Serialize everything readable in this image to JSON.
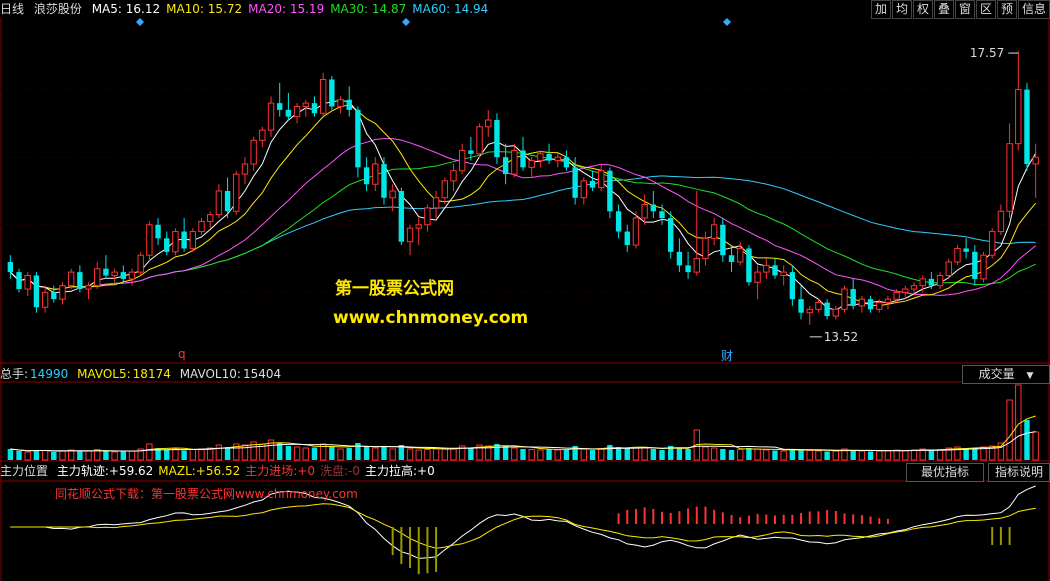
{
  "header": {
    "period": "日线",
    "stock": "浪莎股份",
    "ma": [
      {
        "label": "MA5:",
        "value": "16.12",
        "color": "#ffffff"
      },
      {
        "label": "MA10:",
        "value": "15.72",
        "color": "#ffe900"
      },
      {
        "label": "MA20:",
        "value": "15.19",
        "color": "#ff55ff"
      },
      {
        "label": "MA30:",
        "value": "14.87",
        "color": "#22dd22"
      },
      {
        "label": "MA60:",
        "value": "14.94",
        "color": "#33ccff"
      }
    ]
  },
  "toolbar": [
    "加",
    "均",
    "权",
    "叠",
    "窗",
    "区",
    "预",
    "信息"
  ],
  "main_panel": {
    "high_label": "17.57",
    "low_label": "13.52",
    "marker_q": "q",
    "marker_cai": "财",
    "watermark_title": "第一股票公式网",
    "watermark_url": "www.chnmoney.com"
  },
  "volume_panel": {
    "label": "总手:",
    "value": "14990",
    "mav5_label": "MAVOL5:",
    "mav5_value": "18174",
    "mav10_label": "MAVOL10:",
    "mav10_value": "15404",
    "dropdown": "成交量"
  },
  "indicator_panel": {
    "name": "主力位置",
    "items": [
      {
        "label": "主力轨迹:",
        "value": "+59.62",
        "color": "#ffffff"
      },
      {
        "label": "MAZL:",
        "value": "+56.52",
        "color": "#ffe900"
      },
      {
        "label": "主力进场:",
        "value": "+0",
        "color": "#ff3333"
      },
      {
        "label": "洗盘:",
        "value": "-0",
        "color": "#993333"
      },
      {
        "label": "主力拉高:",
        "value": "+0",
        "color": "#ffffff"
      }
    ],
    "btn_best": "最优指标",
    "btn_explain": "指标说明",
    "watermark": "同花顺公式下载：第一股票公式网www.chnmoney.com"
  },
  "colors": {
    "up": "#ff3232",
    "down": "#00e6e6",
    "bg": "#000000",
    "grid": "#8b0000"
  },
  "chart_data": {
    "type": "candlestick",
    "ylim": [
      13.0,
      18.0
    ],
    "high": 17.57,
    "low": 13.52,
    "ohlc": [
      [
        14.45,
        14.55,
        14.2,
        14.3
      ],
      [
        14.3,
        14.35,
        14.0,
        14.05
      ],
      [
        14.05,
        14.3,
        13.95,
        14.25
      ],
      [
        14.25,
        14.3,
        13.7,
        13.78
      ],
      [
        13.78,
        14.1,
        13.7,
        14.0
      ],
      [
        14.0,
        14.1,
        13.85,
        13.9
      ],
      [
        13.9,
        14.15,
        13.82,
        14.1
      ],
      [
        14.1,
        14.35,
        14.05,
        14.3
      ],
      [
        14.3,
        14.4,
        14.0,
        14.05
      ],
      [
        14.05,
        14.15,
        13.9,
        14.1
      ],
      [
        14.1,
        14.45,
        14.05,
        14.35
      ],
      [
        14.35,
        14.55,
        14.2,
        14.25
      ],
      [
        14.25,
        14.35,
        14.15,
        14.3
      ],
      [
        14.3,
        14.4,
        14.15,
        14.2
      ],
      [
        14.2,
        14.35,
        14.1,
        14.3
      ],
      [
        14.3,
        14.6,
        14.25,
        14.55
      ],
      [
        14.55,
        15.05,
        14.45,
        15.0
      ],
      [
        15.0,
        15.1,
        14.7,
        14.8
      ],
      [
        14.8,
        14.9,
        14.55,
        14.6
      ],
      [
        14.6,
        14.95,
        14.55,
        14.9
      ],
      [
        14.9,
        15.1,
        14.6,
        14.65
      ],
      [
        14.65,
        14.95,
        14.6,
        14.9
      ],
      [
        14.9,
        15.1,
        14.85,
        15.05
      ],
      [
        15.05,
        15.2,
        14.95,
        15.15
      ],
      [
        15.15,
        15.6,
        15.1,
        15.5
      ],
      [
        15.5,
        15.7,
        15.1,
        15.2
      ],
      [
        15.2,
        15.8,
        15.15,
        15.75
      ],
      [
        15.75,
        16.0,
        15.6,
        15.9
      ],
      [
        15.9,
        16.3,
        15.8,
        16.25
      ],
      [
        16.25,
        16.45,
        16.15,
        16.4
      ],
      [
        16.4,
        16.9,
        16.3,
        16.8
      ],
      [
        16.8,
        17.1,
        16.6,
        16.7
      ],
      [
        16.7,
        16.95,
        16.55,
        16.6
      ],
      [
        16.6,
        16.8,
        16.5,
        16.75
      ],
      [
        16.75,
        16.85,
        16.6,
        16.8
      ],
      [
        16.8,
        16.9,
        16.6,
        16.65
      ],
      [
        16.65,
        17.25,
        16.6,
        17.15
      ],
      [
        17.15,
        17.2,
        16.7,
        16.75
      ],
      [
        16.75,
        16.9,
        16.65,
        16.85
      ],
      [
        16.85,
        17.05,
        16.6,
        16.7
      ],
      [
        16.7,
        16.75,
        15.7,
        15.85
      ],
      [
        15.85,
        16.0,
        15.5,
        15.6
      ],
      [
        15.6,
        16.0,
        15.5,
        15.9
      ],
      [
        15.9,
        16.0,
        15.3,
        15.4
      ],
      [
        15.4,
        15.6,
        15.2,
        15.5
      ],
      [
        15.5,
        15.55,
        14.7,
        14.75
      ],
      [
        14.75,
        15.0,
        14.55,
        14.95
      ],
      [
        14.95,
        15.1,
        14.7,
        15.0
      ],
      [
        15.0,
        15.3,
        14.9,
        15.25
      ],
      [
        15.25,
        15.5,
        15.1,
        15.4
      ],
      [
        15.4,
        15.7,
        15.3,
        15.65
      ],
      [
        15.65,
        15.9,
        15.5,
        15.8
      ],
      [
        15.8,
        16.2,
        15.75,
        16.1
      ],
      [
        16.1,
        16.3,
        15.95,
        16.05
      ],
      [
        16.05,
        16.5,
        16.0,
        16.45
      ],
      [
        16.45,
        16.7,
        16.3,
        16.55
      ],
      [
        16.55,
        16.65,
        15.9,
        16.0
      ],
      [
        16.0,
        16.2,
        15.6,
        15.75
      ],
      [
        15.75,
        16.2,
        15.7,
        16.1
      ],
      [
        16.1,
        16.3,
        15.8,
        15.85
      ],
      [
        15.85,
        16.0,
        15.7,
        15.95
      ],
      [
        15.95,
        16.1,
        15.85,
        16.05
      ],
      [
        16.05,
        16.2,
        15.9,
        15.95
      ],
      [
        15.95,
        16.05,
        15.85,
        16.0
      ],
      [
        16.0,
        16.1,
        15.8,
        15.85
      ],
      [
        15.85,
        16.0,
        15.3,
        15.4
      ],
      [
        15.4,
        15.7,
        15.3,
        15.65
      ],
      [
        15.65,
        15.8,
        15.5,
        15.55
      ],
      [
        15.55,
        15.9,
        15.5,
        15.8
      ],
      [
        15.8,
        15.85,
        15.1,
        15.2
      ],
      [
        15.2,
        15.3,
        14.8,
        14.9
      ],
      [
        14.9,
        15.0,
        14.6,
        14.7
      ],
      [
        14.7,
        15.2,
        14.65,
        15.1
      ],
      [
        15.1,
        15.45,
        15.0,
        15.3
      ],
      [
        15.3,
        15.5,
        15.1,
        15.2
      ],
      [
        15.2,
        15.3,
        15.0,
        15.1
      ],
      [
        15.1,
        15.2,
        14.5,
        14.6
      ],
      [
        14.6,
        14.8,
        14.3,
        14.4
      ],
      [
        14.4,
        14.6,
        14.2,
        14.3
      ],
      [
        14.3,
        15.5,
        14.25,
        14.5
      ],
      [
        14.5,
        14.9,
        14.4,
        14.8
      ],
      [
        14.8,
        15.1,
        14.7,
        15.0
      ],
      [
        15.0,
        15.1,
        14.45,
        14.55
      ],
      [
        14.55,
        14.7,
        14.3,
        14.45
      ],
      [
        14.45,
        14.75,
        14.4,
        14.65
      ],
      [
        14.65,
        14.7,
        14.1,
        14.15
      ],
      [
        14.15,
        14.4,
        13.9,
        14.3
      ],
      [
        14.3,
        14.5,
        14.2,
        14.4
      ],
      [
        14.4,
        14.5,
        14.2,
        14.25
      ],
      [
        14.25,
        14.4,
        14.1,
        14.3
      ],
      [
        14.3,
        14.4,
        13.8,
        13.9
      ],
      [
        13.9,
        14.1,
        13.6,
        13.7
      ],
      [
        13.7,
        13.8,
        13.52,
        13.75
      ],
      [
        13.75,
        13.9,
        13.7,
        13.85
      ],
      [
        13.85,
        13.9,
        13.6,
        13.65
      ],
      [
        13.65,
        13.8,
        13.6,
        13.75
      ],
      [
        13.75,
        14.1,
        13.7,
        14.05
      ],
      [
        14.05,
        14.2,
        13.75,
        13.8
      ],
      [
        13.8,
        13.95,
        13.7,
        13.9
      ],
      [
        13.9,
        13.95,
        13.7,
        13.75
      ],
      [
        13.75,
        13.9,
        13.7,
        13.85
      ],
      [
        13.85,
        13.95,
        13.75,
        13.9
      ],
      [
        13.9,
        14.05,
        13.85,
        14.0
      ],
      [
        14.0,
        14.1,
        13.9,
        14.05
      ],
      [
        14.05,
        14.15,
        13.95,
        14.1
      ],
      [
        14.1,
        14.25,
        14.0,
        14.2
      ],
      [
        14.2,
        14.3,
        14.05,
        14.1
      ],
      [
        14.1,
        14.3,
        14.05,
        14.25
      ],
      [
        14.25,
        14.5,
        14.2,
        14.45
      ],
      [
        14.45,
        14.7,
        14.4,
        14.65
      ],
      [
        14.65,
        14.8,
        14.5,
        14.6
      ],
      [
        14.6,
        14.7,
        14.1,
        14.2
      ],
      [
        14.2,
        14.6,
        14.15,
        14.55
      ],
      [
        14.55,
        14.95,
        14.5,
        14.9
      ],
      [
        14.9,
        15.3,
        14.85,
        15.2
      ],
      [
        15.2,
        16.5,
        15.1,
        16.2
      ],
      [
        16.2,
        17.57,
        16.1,
        17.0
      ],
      [
        17.0,
        17.1,
        15.8,
        15.9
      ],
      [
        15.9,
        16.2,
        15.4,
        16.0
      ]
    ],
    "volume": [
      11000,
      9000,
      8000,
      10000,
      9500,
      8000,
      9000,
      10000,
      8500,
      9000,
      10500,
      9000,
      8000,
      8500,
      9000,
      11000,
      16000,
      12000,
      10000,
      11000,
      9500,
      10500,
      11000,
      12000,
      15000,
      13000,
      16000,
      15000,
      18000,
      16000,
      20000,
      17000,
      14000,
      13000,
      12000,
      12500,
      16000,
      14000,
      11000,
      12000,
      17000,
      14000,
      12000,
      13000,
      11000,
      15000,
      11000,
      10000,
      10500,
      11000,
      12000,
      11500,
      14000,
      12000,
      15000,
      14000,
      16000,
      14000,
      12000,
      11000,
      10500,
      10000,
      11000,
      10000,
      10500,
      14000,
      11000,
      10000,
      11500,
      15000,
      13000,
      12000,
      12500,
      12000,
      11000,
      10000,
      14000,
      12000,
      11000,
      30000,
      13000,
      12000,
      11000,
      10000,
      10500,
      12000,
      11000,
      10000,
      9500,
      9000,
      11000,
      10500,
      9500,
      9000,
      8500,
      9000,
      11000,
      10000,
      9000,
      8500,
      9000,
      9500,
      10000,
      9500,
      10000,
      11000,
      10000,
      10500,
      12000,
      13000,
      12000,
      12500,
      13000,
      14000,
      17000,
      60000,
      75000,
      40000,
      28000
    ]
  }
}
